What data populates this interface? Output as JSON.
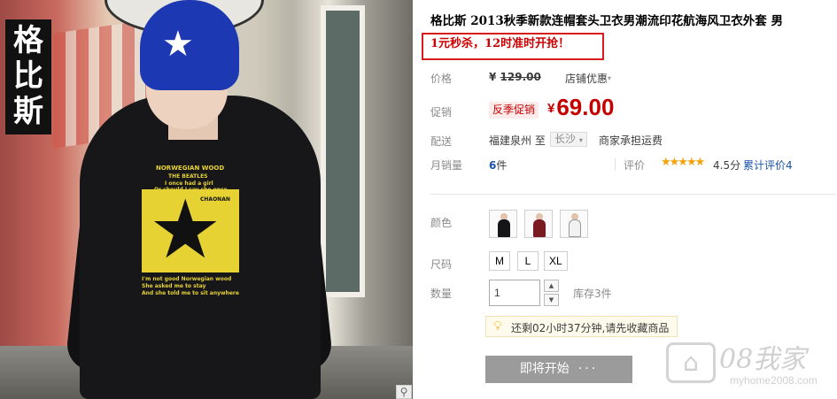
{
  "photo": {
    "brand_tag": "格比斯",
    "print_lines": [
      "NORWEGIAN WOOD",
      "THE BEATLES",
      "I once had a girl",
      "Or should I say she once",
      "CHAONAN",
      "I'm not good Norwegian wood",
      "She asked me to stay",
      "And she told me to sit anywhere"
    ],
    "zoom_icon": "magnifier-icon"
  },
  "product": {
    "title": "格比斯 2013秋季新款连帽套头卫衣男潮流印花航海风卫衣外套 男",
    "promo": "1元秒杀，12时准时开抢！",
    "price_label": "价格",
    "currency": "¥",
    "original_price": "129.00",
    "shop_discount": "店铺优惠",
    "sale_label": "促销",
    "sale_badge": "反季促销",
    "sale_price": "69.00",
    "shipping_label": "配送",
    "ship_from": "福建泉州",
    "ship_to_word": "至",
    "ship_to": "长沙",
    "ship_fee": "商家承担运费",
    "monthly_label": "月销量",
    "monthly_count": "6",
    "monthly_unit": "件",
    "rating_label": "评价",
    "stars": "★★★★★",
    "rating_score": "4.5分",
    "review_link": "累计评价4",
    "color_label": "颜色",
    "colors": [
      {
        "name": "black",
        "hex": "#151518"
      },
      {
        "name": "burgundy",
        "hex": "#7a1b24"
      },
      {
        "name": "white",
        "hex": "#f2f2f2"
      }
    ],
    "size_label": "尺码",
    "sizes": [
      "M",
      "L",
      "XL"
    ],
    "qty_label": "数量",
    "qty_value": "1",
    "stock": "库存3件",
    "tip": "还剩02小时37分钟,请先收藏商品",
    "buy_button": "即将开始",
    "buy_dots": "···"
  },
  "watermark": {
    "brand": "08我家",
    "url": "myhome2008.com"
  },
  "colors": {
    "price_red": "#c40000",
    "promo_border": "#d81c1c",
    "link_blue": "#1a53a8",
    "star_orange": "#f3a20c",
    "button_gray": "#9b9b9b"
  }
}
